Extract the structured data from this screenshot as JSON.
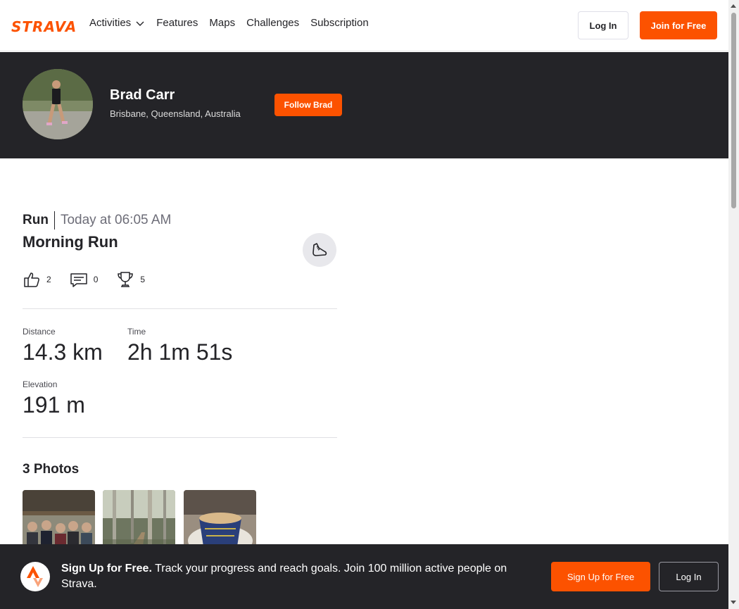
{
  "brand": {
    "logo_text": "STRAVA",
    "accent_color": "#fc5200",
    "dark_color": "#242428"
  },
  "nav": {
    "links": [
      {
        "label": "Activities",
        "has_dropdown": true
      },
      {
        "label": "Features"
      },
      {
        "label": "Maps"
      },
      {
        "label": "Challenges"
      },
      {
        "label": "Subscription"
      }
    ],
    "login_label": "Log In",
    "join_label": "Join for Free"
  },
  "athlete": {
    "name": "Brad Carr",
    "location": "Brisbane, Queensland, Australia",
    "follow_label": "Follow Brad"
  },
  "activity": {
    "type": "Run",
    "datetime": "Today at 06:05 AM",
    "title": "Morning Run",
    "gear_icon": "shoe-icon",
    "kudos_count": "2",
    "comments_count": "0",
    "achievements_count": "5",
    "stats": [
      {
        "label": "Distance",
        "value": "14.3 km"
      },
      {
        "label": "Time",
        "value": "2h 1m 51s"
      },
      {
        "label": "Elevation",
        "value": "191 m"
      }
    ]
  },
  "photos": {
    "title": "3 Photos",
    "items": [
      {
        "name": "group-photo"
      },
      {
        "name": "trail-photo"
      },
      {
        "name": "coffee-photo"
      }
    ]
  },
  "signup_bar": {
    "headline": "Sign Up for Free.",
    "body": "Track your progress and reach goals. Join 100 million active people on Strava.",
    "signup_label": "Sign Up for Free",
    "login_label": "Log In"
  }
}
